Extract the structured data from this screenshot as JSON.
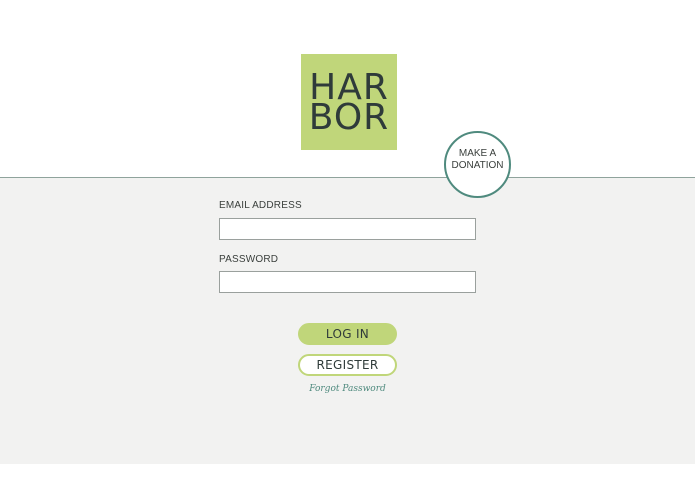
{
  "brand": {
    "logo_line1": "HAR",
    "logo_line2": "BOR",
    "logo_color": "#c0d67a",
    "text_color": "#2f3b3a"
  },
  "donate": {
    "line1": "MAKE A",
    "line2": "DONATION",
    "accent": "#4f8a7e"
  },
  "form": {
    "email_label": "EMAIL ADDRESS",
    "email_value": "",
    "password_label": "PASSWORD",
    "password_value": "",
    "login_label": "LOG IN",
    "register_label": "REGISTER",
    "forgot_label": "Forgot Password"
  },
  "colors": {
    "panel_bg": "#f2f2f1",
    "accent_green": "#c0d67a",
    "link_teal": "#4f8a7e"
  }
}
